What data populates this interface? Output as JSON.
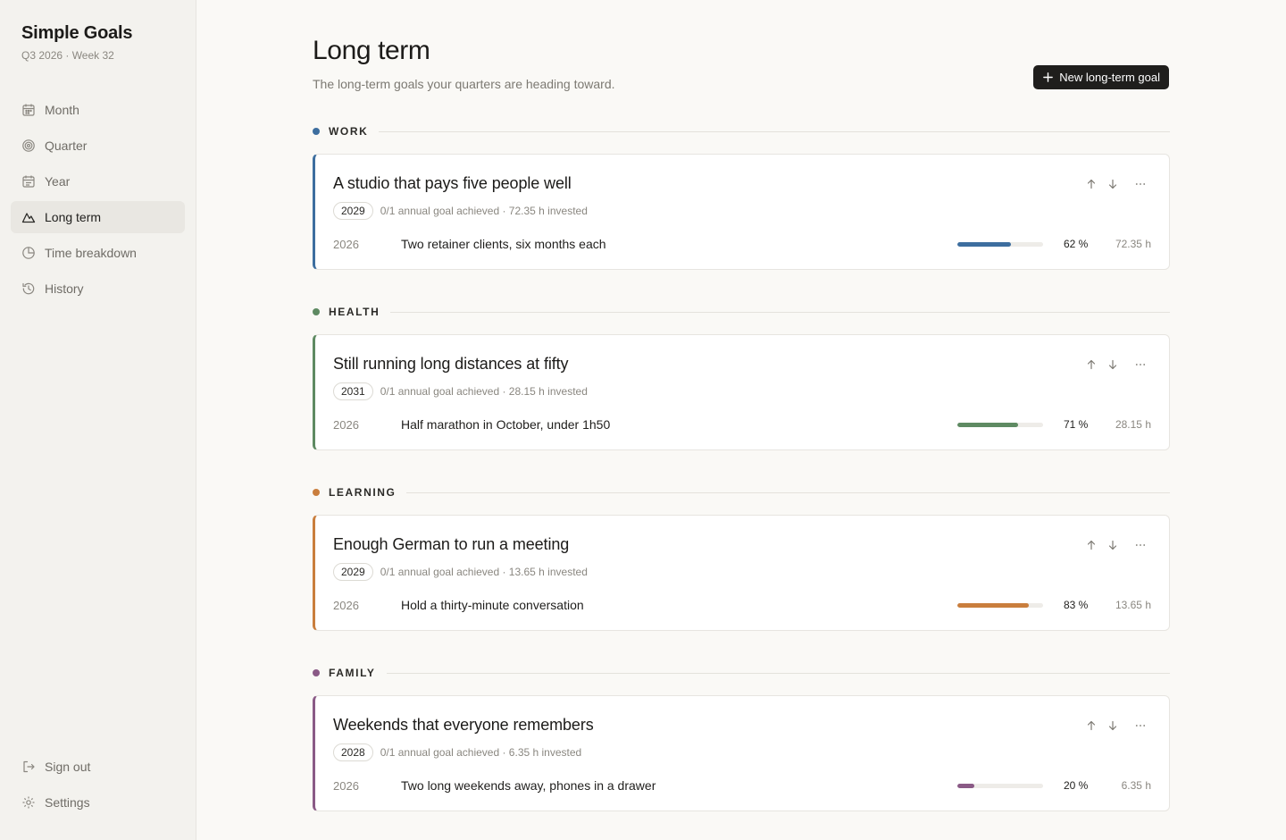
{
  "app": {
    "title": "Simple Goals",
    "period": "Q3 2026 · Week 32"
  },
  "nav": [
    {
      "label": "Month",
      "icon": "calendar-icon",
      "active": false
    },
    {
      "label": "Quarter",
      "icon": "target-icon",
      "active": false
    },
    {
      "label": "Year",
      "icon": "calendar-year-icon",
      "active": false
    },
    {
      "label": "Long term",
      "icon": "mountain-icon",
      "active": true
    },
    {
      "label": "Time breakdown",
      "icon": "pie-chart-icon",
      "active": false
    },
    {
      "label": "History",
      "icon": "history-icon",
      "active": false
    }
  ],
  "nav_bottom": [
    {
      "label": "Sign out",
      "icon": "sign-out-icon"
    },
    {
      "label": "Settings",
      "icon": "gear-icon"
    }
  ],
  "page": {
    "title": "Long term",
    "subtitle": "The long-term goals your quarters are heading toward.",
    "new_button": "New long-term goal"
  },
  "sections": [
    {
      "label": "WORK",
      "color": "#3d6e9f",
      "card": {
        "title": "A studio that pays five people well",
        "year": "2029",
        "meta": "0/1 annual goal achieved · 72.35 h invested",
        "goal": {
          "year": "2026",
          "text": "Two retainer clients, six months each",
          "progress": 62,
          "pct": "62 %",
          "hours": "72.35 h"
        }
      }
    },
    {
      "label": "HEALTH",
      "color": "#5e8a62",
      "card": {
        "title": "Still running long distances at fifty",
        "year": "2031",
        "meta": "0/1 annual goal achieved · 28.15 h invested",
        "goal": {
          "year": "2026",
          "text": "Half marathon in October, under 1h50",
          "progress": 71,
          "pct": "71 %",
          "hours": "28.15 h"
        }
      }
    },
    {
      "label": "LEARNING",
      "color": "#c97e3d",
      "card": {
        "title": "Enough German to run a meeting",
        "year": "2029",
        "meta": "0/1 annual goal achieved · 13.65 h invested",
        "goal": {
          "year": "2026",
          "text": "Hold a thirty-minute conversation",
          "progress": 83,
          "pct": "83 %",
          "hours": "13.65 h"
        }
      }
    },
    {
      "label": "FAMILY",
      "color": "#8a5a86",
      "card": {
        "title": "Weekends that everyone remembers",
        "year": "2028",
        "meta": "0/1 annual goal achieved · 6.35 h invested",
        "goal": {
          "year": "2026",
          "text": "Two long weekends away, phones in a drawer",
          "progress": 20,
          "pct": "20 %",
          "hours": "6.35 h"
        }
      }
    }
  ]
}
